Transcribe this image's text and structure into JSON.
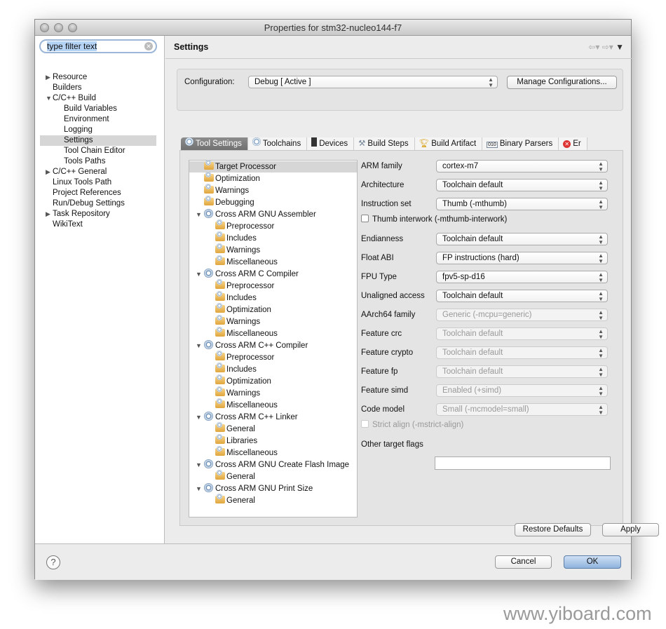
{
  "window": {
    "title": "Properties for stm32-nucleo144-f7"
  },
  "sidebar": {
    "filter_value": "type filter text",
    "items": [
      {
        "label": "Resource",
        "level": 0,
        "arrow": "right"
      },
      {
        "label": "Builders",
        "level": 0,
        "arrow": ""
      },
      {
        "label": "C/C++ Build",
        "level": 0,
        "arrow": "down"
      },
      {
        "label": "Build Variables",
        "level": 1,
        "arrow": ""
      },
      {
        "label": "Environment",
        "level": 1,
        "arrow": ""
      },
      {
        "label": "Logging",
        "level": 1,
        "arrow": ""
      },
      {
        "label": "Settings",
        "level": 1,
        "arrow": "",
        "selected": true
      },
      {
        "label": "Tool Chain Editor",
        "level": 1,
        "arrow": ""
      },
      {
        "label": "Tools Paths",
        "level": 1,
        "arrow": ""
      },
      {
        "label": "C/C++ General",
        "level": 0,
        "arrow": "right"
      },
      {
        "label": "Linux Tools Path",
        "level": 0,
        "arrow": ""
      },
      {
        "label": "Project References",
        "level": 0,
        "arrow": ""
      },
      {
        "label": "Run/Debug Settings",
        "level": 0,
        "arrow": ""
      },
      {
        "label": "Task Repository",
        "level": 0,
        "arrow": "right"
      },
      {
        "label": "WikiText",
        "level": 0,
        "arrow": ""
      }
    ]
  },
  "header": {
    "title": "Settings"
  },
  "config": {
    "label": "Configuration:",
    "value": "Debug  [ Active ]",
    "manage_label": "Manage Configurations..."
  },
  "tabs": [
    {
      "label": "Tool Settings",
      "icon": "gear-icon",
      "active": true
    },
    {
      "label": "Toolchains",
      "icon": "gear-icon"
    },
    {
      "label": "Devices",
      "icon": "chip-icon"
    },
    {
      "label": "Build Steps",
      "icon": "wrench-icon"
    },
    {
      "label": "Build Artifact",
      "icon": "trophy-icon"
    },
    {
      "label": "Binary Parsers",
      "icon": "binary-icon"
    },
    {
      "label": "Er",
      "icon": "error-icon"
    }
  ],
  "tree": [
    {
      "label": "Target Processor",
      "kind": "folder",
      "level": 0,
      "selected": true
    },
    {
      "label": "Optimization",
      "kind": "folder",
      "level": 0
    },
    {
      "label": "Warnings",
      "kind": "folder",
      "level": 0
    },
    {
      "label": "Debugging",
      "kind": "folder",
      "level": 0
    },
    {
      "label": "Cross ARM GNU Assembler",
      "kind": "tool",
      "level": 0
    },
    {
      "label": "Preprocessor",
      "kind": "folder",
      "level": 1
    },
    {
      "label": "Includes",
      "kind": "folder",
      "level": 1
    },
    {
      "label": "Warnings",
      "kind": "folder",
      "level": 1
    },
    {
      "label": "Miscellaneous",
      "kind": "folder",
      "level": 1
    },
    {
      "label": "Cross ARM C Compiler",
      "kind": "tool",
      "level": 0
    },
    {
      "label": "Preprocessor",
      "kind": "folder",
      "level": 1
    },
    {
      "label": "Includes",
      "kind": "folder",
      "level": 1
    },
    {
      "label": "Optimization",
      "kind": "folder",
      "level": 1
    },
    {
      "label": "Warnings",
      "kind": "folder",
      "level": 1
    },
    {
      "label": "Miscellaneous",
      "kind": "folder",
      "level": 1
    },
    {
      "label": "Cross ARM C++ Compiler",
      "kind": "tool",
      "level": 0
    },
    {
      "label": "Preprocessor",
      "kind": "folder",
      "level": 1
    },
    {
      "label": "Includes",
      "kind": "folder",
      "level": 1
    },
    {
      "label": "Optimization",
      "kind": "folder",
      "level": 1
    },
    {
      "label": "Warnings",
      "kind": "folder",
      "level": 1
    },
    {
      "label": "Miscellaneous",
      "kind": "folder",
      "level": 1
    },
    {
      "label": "Cross ARM C++ Linker",
      "kind": "tool",
      "level": 0
    },
    {
      "label": "General",
      "kind": "folder",
      "level": 1
    },
    {
      "label": "Libraries",
      "kind": "folder",
      "level": 1
    },
    {
      "label": "Miscellaneous",
      "kind": "folder",
      "level": 1
    },
    {
      "label": "Cross ARM GNU Create Flash Image",
      "kind": "tool",
      "level": 0
    },
    {
      "label": "General",
      "kind": "folder",
      "level": 1
    },
    {
      "label": "Cross ARM GNU Print Size",
      "kind": "tool",
      "level": 0
    },
    {
      "label": "General",
      "kind": "folder",
      "level": 1
    }
  ],
  "form": [
    {
      "type": "select",
      "label": "ARM family",
      "value": "cortex-m7",
      "enabled": true
    },
    {
      "type": "select",
      "label": "Architecture",
      "value": "Toolchain default",
      "enabled": true
    },
    {
      "type": "select",
      "label": "Instruction set",
      "value": "Thumb (-mthumb)",
      "enabled": true
    },
    {
      "type": "checkbox",
      "label": "Thumb interwork (-mthumb-interwork)",
      "checked": false,
      "enabled": true
    },
    {
      "type": "select",
      "label": "Endianness",
      "value": "Toolchain default",
      "enabled": true
    },
    {
      "type": "select",
      "label": "Float ABI",
      "value": "FP instructions (hard)",
      "enabled": true
    },
    {
      "type": "select",
      "label": "FPU Type",
      "value": "fpv5-sp-d16",
      "enabled": true
    },
    {
      "type": "select",
      "label": "Unaligned access",
      "value": "Toolchain default",
      "enabled": true
    },
    {
      "type": "select",
      "label": "AArch64 family",
      "value": "Generic (-mcpu=generic)",
      "enabled": false
    },
    {
      "type": "select",
      "label": "Feature crc",
      "value": "Toolchain default",
      "enabled": false
    },
    {
      "type": "select",
      "label": "Feature crypto",
      "value": "Toolchain default",
      "enabled": false
    },
    {
      "type": "select",
      "label": "Feature fp",
      "value": "Toolchain default",
      "enabled": false
    },
    {
      "type": "select",
      "label": "Feature simd",
      "value": "Enabled (+simd)",
      "enabled": false
    },
    {
      "type": "select",
      "label": "Code model",
      "value": "Small (-mcmodel=small)",
      "enabled": false
    },
    {
      "type": "checkbox",
      "label": "Strict align (-mstrict-align)",
      "checked": false,
      "enabled": false
    },
    {
      "type": "text",
      "label": "Other target flags",
      "value": ""
    }
  ],
  "buttons": {
    "restore": "Restore Defaults",
    "apply": "Apply",
    "cancel": "Cancel",
    "ok": "OK",
    "help": "?"
  },
  "watermark": "www.yiboard.com"
}
